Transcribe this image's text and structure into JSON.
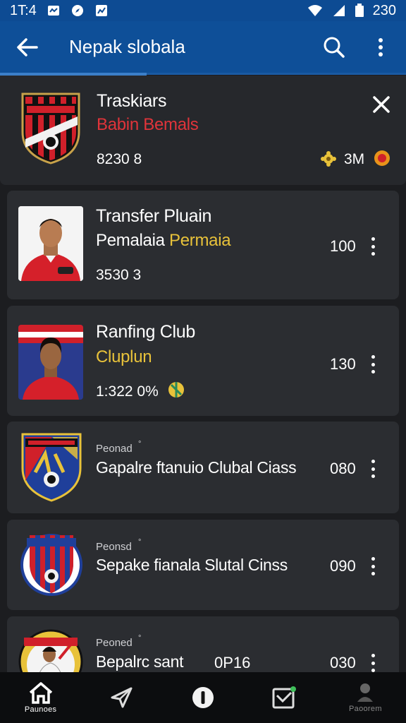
{
  "status_bar": {
    "time": "1T:4",
    "battery_text": "230"
  },
  "app_bar": {
    "title": "Nepak slobala"
  },
  "cards": [
    {
      "title": "Traskiars",
      "subtitle": "Babin Bemals",
      "stat": "8230 8",
      "score": "3M"
    },
    {
      "title": "Transfer Pluain",
      "subtitle_a": "Pemalaia",
      "subtitle_b": "Permaia",
      "stat": "3530 3",
      "value": "100"
    },
    {
      "title": "Ranfing Club",
      "subtitle": "Cluplun",
      "stat": "1:322 0%",
      "value": "130"
    },
    {
      "kicker": "Peonad",
      "title": "Gapalre ftanuio Clubal Ciass",
      "value": "080"
    },
    {
      "kicker": "Peonsd",
      "title": "Sepake fianala Slutal Cinss",
      "value": "090"
    },
    {
      "kicker": "Peoned",
      "title": "Bepalrc sant",
      "extra": "0P16",
      "value": "030"
    }
  ],
  "bottom_nav": [
    {
      "label": "Paunoes",
      "icon": "home-icon"
    },
    {
      "label": "",
      "icon": "send-icon"
    },
    {
      "label": "",
      "icon": "info-icon"
    },
    {
      "label": "",
      "icon": "mail-icon"
    },
    {
      "label": "Paoorem",
      "icon": "profile-icon"
    }
  ]
}
